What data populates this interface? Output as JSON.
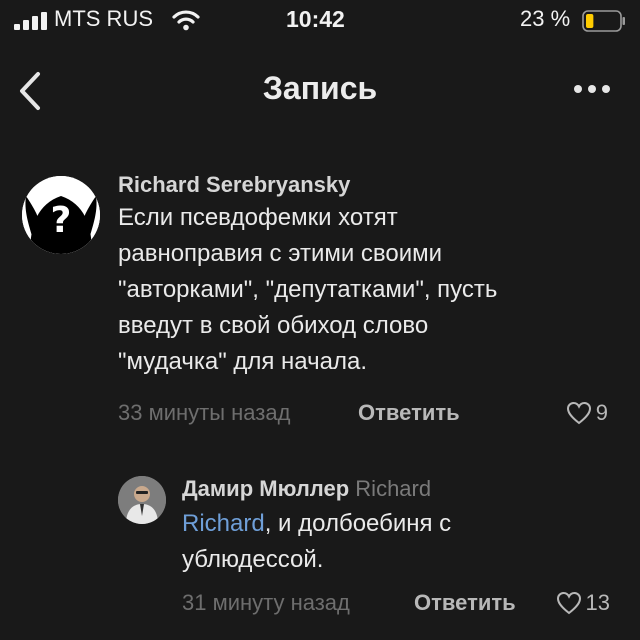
{
  "status_bar": {
    "carrier": "MTS RUS",
    "time": "10:42",
    "battery_percent": "23 %",
    "icons": [
      "signal-icon",
      "wifi-icon",
      "battery-icon"
    ],
    "battery_level": 0.23,
    "battery_color": "#ffcc00"
  },
  "nav": {
    "title": "Запись",
    "icons": [
      "back-icon",
      "more-icon"
    ]
  },
  "comment": {
    "author": "Richard Serebryansky",
    "text_lines": [
      "Если псевдофемки хотят",
      "равноправия с этими своими",
      "\"авторками\", \"депутатками\", пусть",
      "введут в свой обиход слово",
      "\"мудачка\" для начала."
    ],
    "time": "33 минуты назад",
    "reply_label": "Ответить",
    "likes": "9"
  },
  "reply": {
    "author": "Дамир Мюллер",
    "addressee": "Richard",
    "mention": "Richard",
    "text_first": ", и долбоебиня с",
    "text_second": "ублюдессой.",
    "time": "31 минуту назад",
    "reply_label": "Ответить",
    "likes": "13"
  },
  "colors": {
    "background": "#191919",
    "mention": "#6f9fd8",
    "muted": "#6e6e6e"
  }
}
